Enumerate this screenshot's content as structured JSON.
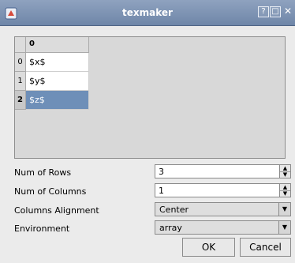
{
  "window": {
    "title": "texmaker",
    "help_icon": "?",
    "maximize_icon": "□",
    "close_icon": "✕"
  },
  "table": {
    "column_header": "0",
    "rows": [
      {
        "index": "0",
        "value": "$x$"
      },
      {
        "index": "1",
        "value": "$y$"
      },
      {
        "index": "2",
        "value": "$z$"
      }
    ],
    "selected_row": 2
  },
  "form": {
    "num_rows": {
      "label": "Num of Rows",
      "value": "3"
    },
    "num_columns": {
      "label": "Num of Columns",
      "value": "1"
    },
    "columns_alignment": {
      "label": "Columns Alignment",
      "value": "Center"
    },
    "environment": {
      "label": "Environment",
      "value": "array"
    }
  },
  "buttons": {
    "ok": "OK",
    "cancel": "Cancel"
  }
}
